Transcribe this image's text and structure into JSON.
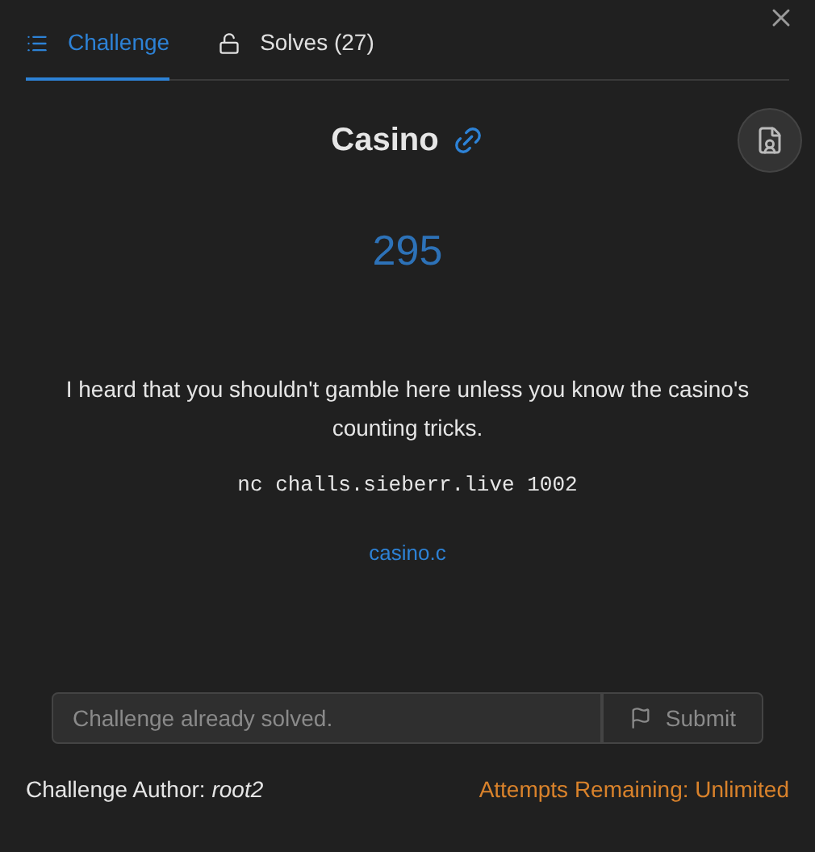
{
  "tabs": [
    {
      "label": "Challenge",
      "kind": "list",
      "selected": true
    },
    {
      "label": "Solves (27)",
      "kind": "lock",
      "selected": false
    }
  ],
  "challenge": {
    "name": "Casino",
    "points": "295",
    "description": "I heard that you shouldn't gamble here unless you know the casino's counting tricks.",
    "connection": "nc challs.sieberr.live 1002",
    "file": "casino.c"
  },
  "submission": {
    "placeholder": "Challenge already solved.",
    "disabled": true,
    "button": "Submit"
  },
  "footer": {
    "author": "Challenge Author: *root2*",
    "attempts": "Attempts Remaining: Unlimited"
  }
}
